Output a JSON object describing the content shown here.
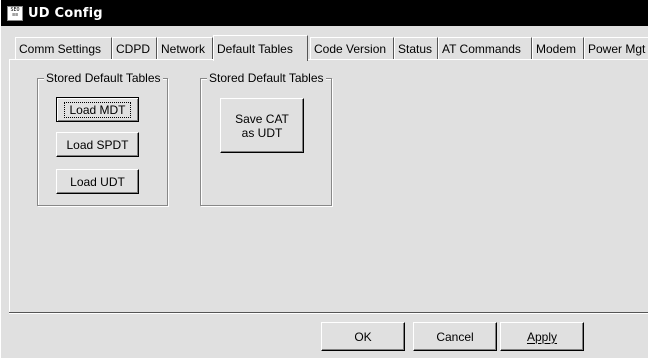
{
  "window": {
    "title": "UD Config",
    "icon_text_top": "SEO",
    "icon_text_bottom": "≡≡"
  },
  "tabs": [
    {
      "label": "Comm Settings",
      "active": false
    },
    {
      "label": "CDPD",
      "active": false
    },
    {
      "label": "Network",
      "active": false
    },
    {
      "label": "Default Tables",
      "active": true
    },
    {
      "label": "Code Version",
      "active": false
    },
    {
      "label": "Status",
      "active": false
    },
    {
      "label": "AT Commands",
      "active": false
    },
    {
      "label": "Modem",
      "active": false
    },
    {
      "label": "Power Mgt",
      "active": false
    }
  ],
  "group_load": {
    "label": "Stored Default Tables",
    "buttons": {
      "load_mdt": "Load MDT",
      "load_spdt": "Load SPDT",
      "load_udt": "Load UDT"
    }
  },
  "group_save": {
    "label": "Stored Default Tables",
    "save_button": "Save CAT\n   as UDT"
  },
  "footer": {
    "ok": "OK",
    "cancel": "Cancel",
    "apply": "Apply"
  },
  "colors": {
    "face": "#e0e0e0",
    "titlebar": "#000000",
    "title_text": "#ffffff"
  }
}
